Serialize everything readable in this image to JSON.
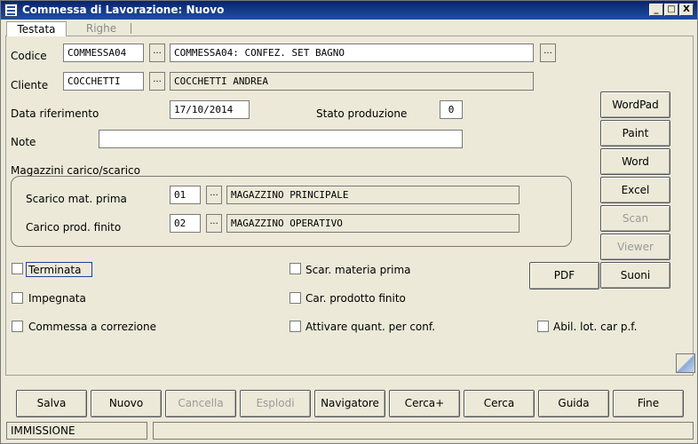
{
  "window": {
    "title": "Commessa di Lavorazione: Nuovo",
    "minimize": "_",
    "maximize": "□",
    "close": "X"
  },
  "tabs": [
    {
      "label": "Testata"
    },
    {
      "label": "Righe"
    }
  ],
  "form": {
    "codice": {
      "label": "Codice",
      "code": "COMMESSA04",
      "desc": "COMMESSA04: CONFEZ. SET BAGNO"
    },
    "cliente": {
      "label": "Cliente",
      "code": "COCCHETTI",
      "desc": "COCCHETTI ANDREA"
    },
    "data_rif": {
      "label": "Data riferimento",
      "value": "17/10/2014"
    },
    "stato": {
      "label": "Stato produzione",
      "value": "0"
    },
    "note": {
      "label": "Note",
      "value": ""
    },
    "magazzini": {
      "label": "Magazzini carico/scarico",
      "scarico": {
        "label": "Scarico mat. prima",
        "code": "01",
        "desc": "MAGAZZINO PRINCIPALE"
      },
      "carico": {
        "label": "Carico prod. finito",
        "code": "02",
        "desc": "MAGAZZINO OPERATIVO"
      }
    },
    "ellipsis": "..."
  },
  "checkboxes": {
    "terminata": "Terminata",
    "impegnata": "Impegnata",
    "correzione": "Commessa a correzione",
    "scar_materia": "Scar. materia prima",
    "car_prodotto": "Car. prodotto finito",
    "attivare_quant": "Attivare quant. per conf.",
    "abil_lot": "Abil. lot. car p.f."
  },
  "side_buttons": {
    "wordpad": "WordPad",
    "paint": "Paint",
    "word": "Word",
    "excel": "Excel",
    "scan": "Scan",
    "viewer": "Viewer",
    "pdf": "PDF",
    "suoni": "Suoni"
  },
  "bottom_buttons": {
    "salva": "Salva",
    "nuovo": "Nuovo",
    "cancella": "Cancella",
    "esplodi": "Esplodi",
    "navigatore": "Navigatore",
    "cerca_plus": "Cerca+",
    "cerca": "Cerca",
    "guida": "Guida",
    "fine": "Fine"
  },
  "status": {
    "mode": "IMMISSIONE",
    "info": ""
  }
}
